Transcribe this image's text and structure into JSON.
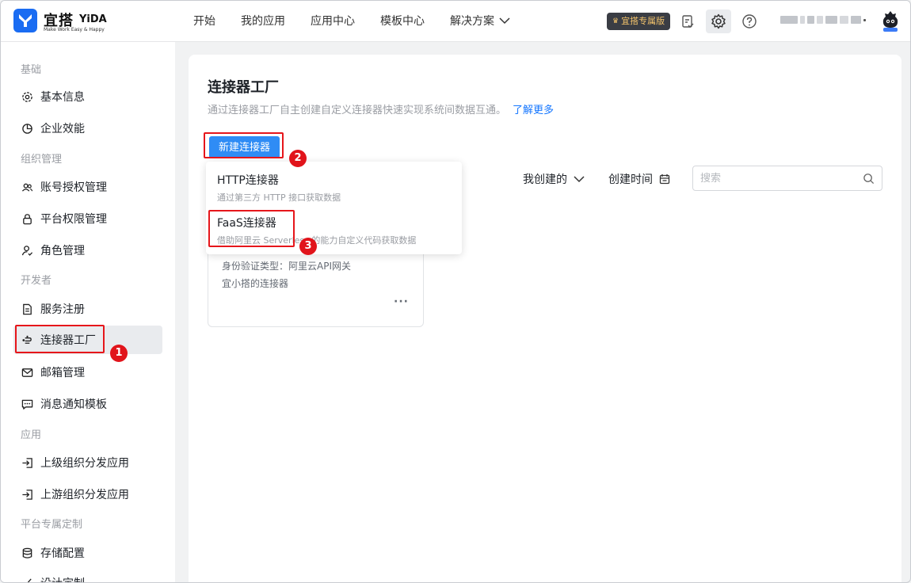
{
  "header": {
    "logo_cn": "宜搭",
    "logo_en": "YiDA",
    "logo_slogan": "Make Work Easy & Happy",
    "nav": [
      "开始",
      "我的应用",
      "应用中心",
      "模板中心",
      "解决方案"
    ],
    "exclusive_badge": "宜搭专属版",
    "icons": [
      "todo-icon",
      "gear-icon",
      "help-icon"
    ]
  },
  "sidebar": {
    "groups": [
      "基础",
      "组织管理",
      "开发者",
      "应用",
      "平台专属定制"
    ],
    "items": [
      {
        "label": "基本信息",
        "icon": "gear-icon"
      },
      {
        "label": "企业效能",
        "icon": "pie-chart-icon"
      },
      {
        "label": "账号授权管理",
        "icon": "users-icon"
      },
      {
        "label": "平台权限管理",
        "icon": "lock-icon"
      },
      {
        "label": "角色管理",
        "icon": "user-check-icon"
      },
      {
        "label": "服务注册",
        "icon": "document-icon"
      },
      {
        "label": "连接器工厂",
        "icon": "connector-icon"
      },
      {
        "label": "邮箱管理",
        "icon": "mail-icon"
      },
      {
        "label": "消息通知模板",
        "icon": "message-icon"
      },
      {
        "label": "上级组织分发应用",
        "icon": "enter-icon"
      },
      {
        "label": "上游组织分发应用",
        "icon": "enter-icon"
      },
      {
        "label": "存储配置",
        "icon": "database-icon"
      },
      {
        "label": "设计定制",
        "icon": "brush-icon"
      }
    ]
  },
  "main": {
    "title": "连接器工厂",
    "description": "通过连接器工厂自主创建自定义连接器快速实现系统间数据互通。",
    "learn_more": "了解更多",
    "new_button": "新建连接器",
    "dropdown": [
      {
        "title": "HTTP连接器",
        "desc": "通过第三方 HTTP 接口获取数据"
      },
      {
        "title": "FaaS连接器",
        "desc": "借助阿里云 Serverless 的能力自定义代码获取数据"
      }
    ],
    "filter_mine": "我创建的",
    "filter_time": "创建时间",
    "search_placeholder": "搜索",
    "card": {
      "auth_type": "身份验证类型：阿里云API网关",
      "desc": "宜小搭的连接器",
      "more": "···"
    }
  },
  "annotations": [
    "1",
    "2",
    "3"
  ],
  "colors": {
    "accent": "#2f8cf5",
    "link": "#1677ff",
    "highlight": "#e6161b",
    "badge_bg": "#3a3d44",
    "badge_text": "#f4c46c"
  }
}
